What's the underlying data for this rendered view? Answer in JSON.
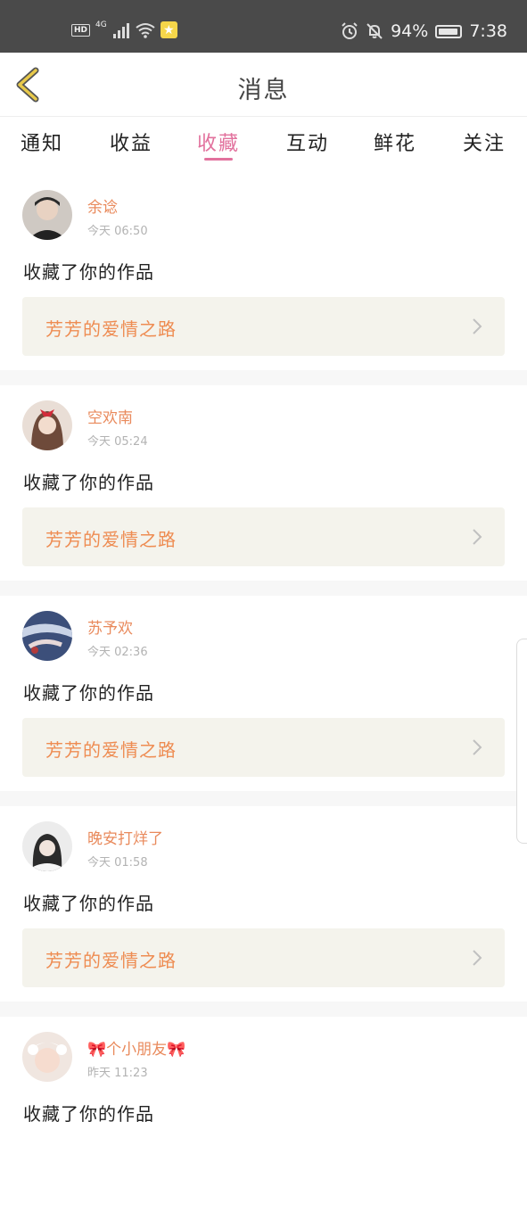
{
  "status_bar": {
    "hd": "HD",
    "network": "4G",
    "battery": "94%",
    "time": "7:38",
    "battery_level": 0.94
  },
  "header": {
    "title": "消息"
  },
  "tabs": [
    {
      "label": "通知",
      "active": false
    },
    {
      "label": "收益",
      "active": false
    },
    {
      "label": "收藏",
      "active": true
    },
    {
      "label": "互动",
      "active": false
    },
    {
      "label": "鲜花",
      "active": false
    },
    {
      "label": "关注",
      "active": false
    }
  ],
  "messages": [
    {
      "user": "余谂",
      "time": "今天 06:50",
      "action": "收藏了你的作品",
      "work": "芳芳的爱情之路"
    },
    {
      "user": "空欢南",
      "time": "今天 05:24",
      "action": "收藏了你的作品",
      "work": "芳芳的爱情之路"
    },
    {
      "user": "苏予欢",
      "time": "今天 02:36",
      "action": "收藏了你的作品",
      "work": "芳芳的爱情之路"
    },
    {
      "user": "晚安打烊了",
      "time": "今天 01:58",
      "action": "收藏了你的作品",
      "work": "芳芳的爱情之路"
    },
    {
      "user": "🎀个小朋友🎀",
      "time": "昨天 11:23",
      "action": "收藏了你的作品",
      "work": ""
    }
  ],
  "colors": {
    "accent": "#e2719d",
    "username": "#e98a5c",
    "work_title": "#ee8c52",
    "card_bg": "#f4f3ec",
    "back_icon": "#e8c94a"
  }
}
